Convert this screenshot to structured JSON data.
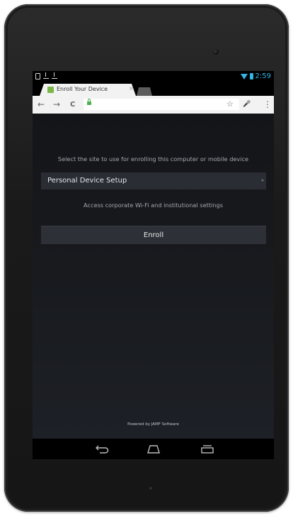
{
  "browser": {
    "tab_title": "Enroll Your Device",
    "tab_close": "×"
  },
  "status_bar": {
    "time": "2:59"
  },
  "page": {
    "prompt": "Select the site to use for enrolling this computer or mobile device",
    "site_select": {
      "selected": "Personal Device Setup"
    },
    "description": "Access corporate Wi-Fi and institutional settings",
    "enroll_label": "Enroll",
    "footer": "Powered by JAMF Software"
  },
  "icons": {
    "back": "←",
    "forward": "→",
    "reload": "C",
    "star": "☆",
    "mic": "🎤",
    "menu": "⋮"
  },
  "colors": {
    "accent": "#33b5e5",
    "favicon": "#7ab648",
    "lock": "#4caf50",
    "page_bg": "#17191d",
    "button_bg": "#2d3036"
  }
}
